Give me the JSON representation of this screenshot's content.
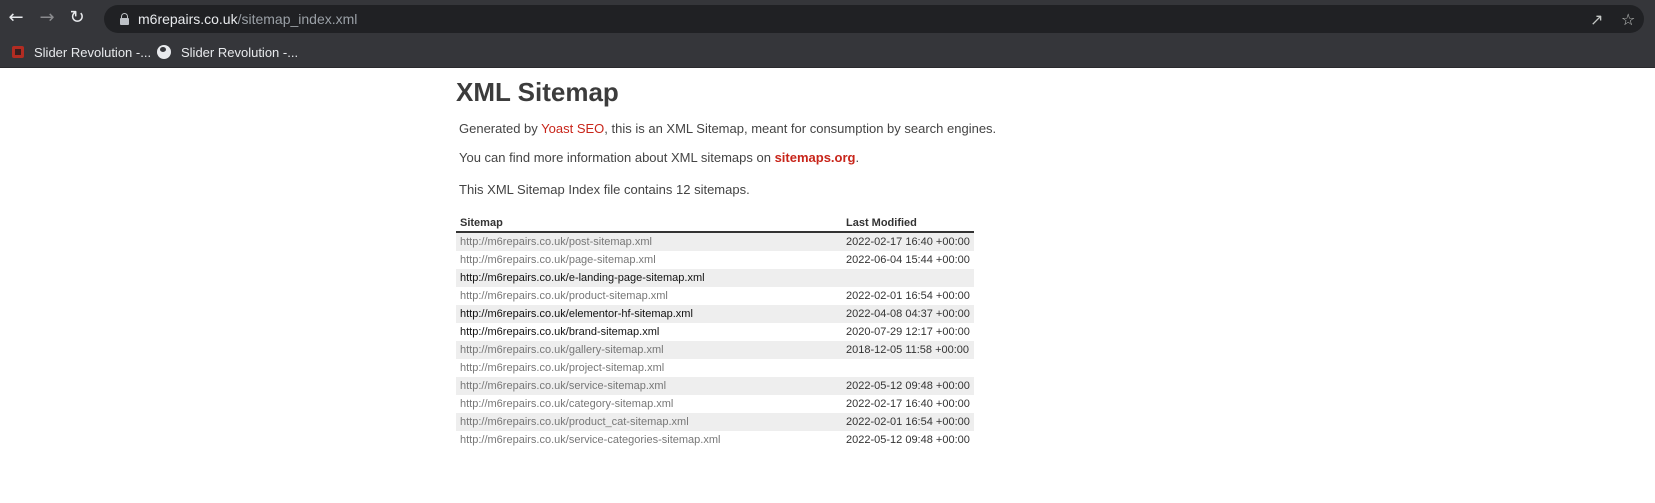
{
  "browser": {
    "url_host": "m6repairs.co.uk",
    "url_path": "/sitemap_index.xml",
    "bookmarks": [
      "Slider Revolution -...",
      "Slider Revolution -..."
    ]
  },
  "page": {
    "title": "XML Sitemap",
    "intro": {
      "prefix": "Generated by ",
      "link": "Yoast SEO",
      "suffix": ", this is an XML Sitemap, meant for consumption by search engines."
    },
    "info": {
      "prefix": "You can find more information about XML sitemaps on ",
      "link": "sitemaps.org",
      "suffix": "."
    },
    "count_text": "This XML Sitemap Index file contains 12 sitemaps."
  },
  "table": {
    "headers": [
      "Sitemap",
      "Last Modified"
    ],
    "rows": [
      {
        "url": "http://m6repairs.co.uk/post-sitemap.xml",
        "modified": "2022-02-17 16:40 +00:00",
        "visited": false
      },
      {
        "url": "http://m6repairs.co.uk/page-sitemap.xml",
        "modified": "2022-06-04 15:44 +00:00",
        "visited": false
      },
      {
        "url": "http://m6repairs.co.uk/e-landing-page-sitemap.xml",
        "modified": "",
        "visited": true
      },
      {
        "url": "http://m6repairs.co.uk/product-sitemap.xml",
        "modified": "2022-02-01 16:54 +00:00",
        "visited": false
      },
      {
        "url": "http://m6repairs.co.uk/elementor-hf-sitemap.xml",
        "modified": "2022-04-08 04:37 +00:00",
        "visited": true
      },
      {
        "url": "http://m6repairs.co.uk/brand-sitemap.xml",
        "modified": "2020-07-29 12:17 +00:00",
        "visited": true
      },
      {
        "url": "http://m6repairs.co.uk/gallery-sitemap.xml",
        "modified": "2018-12-05 11:58 +00:00",
        "visited": false
      },
      {
        "url": "http://m6repairs.co.uk/project-sitemap.xml",
        "modified": "",
        "visited": false
      },
      {
        "url": "http://m6repairs.co.uk/service-sitemap.xml",
        "modified": "2022-05-12 09:48 +00:00",
        "visited": false
      },
      {
        "url": "http://m6repairs.co.uk/category-sitemap.xml",
        "modified": "2022-02-17 16:40 +00:00",
        "visited": false
      },
      {
        "url": "http://m6repairs.co.uk/product_cat-sitemap.xml",
        "modified": "2022-02-01 16:54 +00:00",
        "visited": false
      },
      {
        "url": "http://m6repairs.co.uk/service-categories-sitemap.xml",
        "modified": "2022-05-12 09:48 +00:00",
        "visited": false
      }
    ]
  },
  "colors": {
    "link": "#c8251a",
    "chrome_bg": "#35363a",
    "omnibox_bg": "#202124"
  },
  "icons": [
    "back-arrow-icon",
    "forward-arrow-icon",
    "reload-icon",
    "lock-icon",
    "share-icon",
    "star-icon",
    "bookmark-favicon",
    "globe-icon"
  ]
}
